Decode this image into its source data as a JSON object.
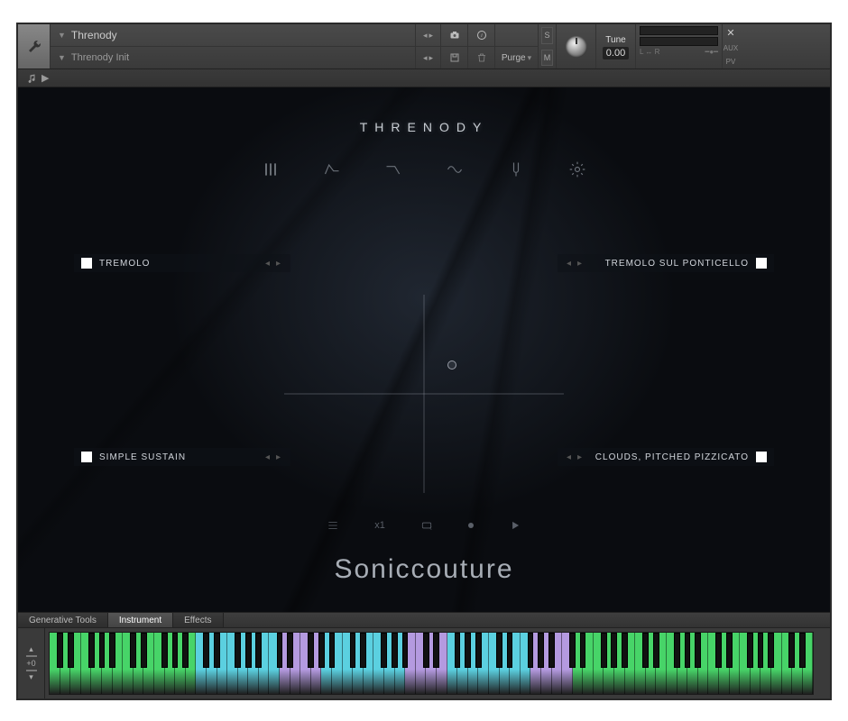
{
  "header": {
    "instrument_name": "Threnody",
    "preset_name": "Threnody Init",
    "purge_label": "Purge",
    "tune_label": "Tune",
    "tune_value": "0.00",
    "solo": "S",
    "mute": "M",
    "aux_label": "AUX",
    "pv_label": "PV",
    "info_label": "i"
  },
  "panel": {
    "title": "THRENODY",
    "brand": "Soniccouture",
    "slots": {
      "tl": "TREMOLO",
      "tr": "TREMOLO SUL PONTICELLO",
      "bl": "SIMPLE SUSTAIN",
      "br": "CLOUDS, PITCHED PIZZICATO"
    },
    "transport_speed": "x1"
  },
  "tabs": {
    "gen": "Generative Tools",
    "inst": "Instrument",
    "fx": "Effects"
  },
  "kb": {
    "transpose": "+0"
  },
  "key_colors": {
    "green": "#47d468",
    "cyan": "#5bd0e0",
    "lav": "#b49ae0"
  },
  "white_key_zones": [
    {
      "start": 0,
      "end": 13,
      "c": "green"
    },
    {
      "start": 14,
      "end": 21,
      "c": "cyan"
    },
    {
      "start": 22,
      "end": 25,
      "c": "lav"
    },
    {
      "start": 26,
      "end": 33,
      "c": "cyan"
    },
    {
      "start": 34,
      "end": 37,
      "c": "lav"
    },
    {
      "start": 38,
      "end": 45,
      "c": "cyan"
    },
    {
      "start": 46,
      "end": 49,
      "c": "lav"
    },
    {
      "start": 50,
      "end": 72,
      "c": "green"
    }
  ]
}
